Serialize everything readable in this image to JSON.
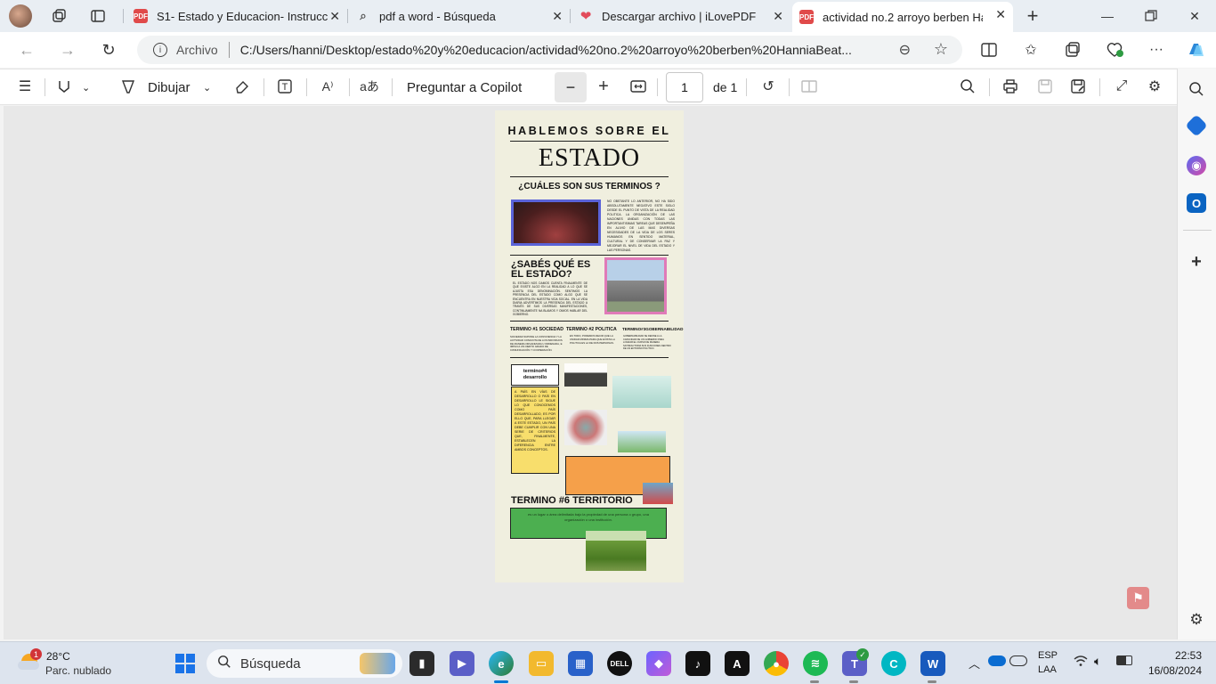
{
  "tabs": [
    {
      "title": "S1- Estado y Educacion- Instrucc",
      "favicon": "pdf-icon"
    },
    {
      "title": "pdf a word - Búsqueda",
      "favicon": "search-icon"
    },
    {
      "title": "Descargar archivo | iLovePDF",
      "favicon": "heart-icon"
    },
    {
      "title": "actividad no.2 arroyo berben Ha",
      "favicon": "pdf-icon",
      "active": true
    }
  ],
  "address": {
    "scheme": "Archivo",
    "url": "C:/Users/hanni/Desktop/estado%20y%20educacion/actividad%20no.2%20arroyo%20berben%20HanniaBeat..."
  },
  "pdf_toolbar": {
    "draw_label": "Dibujar",
    "copilot_label": "Preguntar a Copilot",
    "page_current": "1",
    "page_total": "de 1"
  },
  "document": {
    "heading_small": "HABLEMOS SOBRE EL",
    "heading_big": "ESTADO",
    "q1": "¿CUÁLES SON SUS TERMINOS ?",
    "q1_text": "NO OBSTANTE LO ANTERIOR, NO HA SIDO ABSOLUTAMENTE NEGATIVO ESTE SIGLO DESDE EL PUNTO DE VISTA DE LA REALIDAD POLITICA. LA ORGANIZACIÓN DE LAS NACIONES UNIDAS CON TODAS LAS IMPORTANTISIMAS TAREAS QUE DESEMPEÑA EN ALIVIO DE LAS MAS DIVERSAS NECESIDADES DE LA VIDA DE LOS SERES HUMANOS EN SENTIDO MATERIAL, CULTURAL Y DE CONSERVAR LA PAZ Y MEJORAR EL NIVEL DE VIDA DEL ESTADO Y LAS PERSONAS.",
    "q2": "¿SABÉS QUÉ ES EL ESTADO?",
    "q2_text": "EL ESTADO NOS DAMOS CUENTA FINALMENTE DE QUE EXISTE ALGO EN LA REALIDAD A LO QUE SE AJUSTA ESA DENOMINACIÓN. SENTIMOS LA PRESENCIA DEL ESTADO COMO ALGO QUE SE ENCUENTRA EN NUESTRA VIDA SOCIAL. EN LA VIDA DIARIA ADVERTIMOS LA PRESENCIA DEL ESTADO A TRAVÉS DE SUS DIVERSAS MANIFESTACIONES, CONTINUAMENTE NA BLAMOS Y OIMOS HABLAR DEL GOBIERNO.",
    "t1": "TERMINO #1 SOCIEDAD",
    "t1_text": "SOCIEDAD SUPONE LA CONVIVENCIA Y LA ACTIVIDAD CONJUNTA DE LOS INDIVIDUOS DE MANERA ORGANIZADA U ORDENADA, E IMPLICA UN CIERTO GRADO DE COMUNICACIÓN Y COOPERACIÓN.",
    "t2": "TERMINO #2 POLITICA",
    "t2_text": "ES TODO, PODEMOS DECIR QUE LA UNIDAD MINIMA PARA QUE EXISTA LA POLITICA ES LA DE DOS PERSONAS.",
    "t3": "TERMINO#3GOBERNABILIDAD",
    "t3_text": "GOBERNABILIDAD SE DEFINE A LA CAPACIDAD DE UN GOBIERNO PARA LOGRAR EL CURSO DE MANERA SATISFACTORIA SUS FUNCIONES DENTRO DE UN ENTORNO POLÍTICO.",
    "t4": "termino#4 desarrollo",
    "t4_text": "A PAÍS EN VÍAS DE DESARROLLO O PAÍS EN DESARROLLO LE SIGUE LO QUE CONOCEMOS COMO PAÍS DESARROLLADO, ES POR ELLO QUE, PARA LLEGAR A ESTE ESTADO, UN PAÍS DEBE CUMPLIR CON UNA SERIE DE CRITERIOS QUE, FINALMENTE, ESTABLECEN LA DIFERENCIA ENTRE AMBOS CONCEPTOS.",
    "t6": "TERMINO #6 TERRITORIO",
    "t6_text": "es un lugar o área delimitada bajo la propiedad de una persona o grupo, una organización o una institución."
  },
  "taskbar": {
    "weather_temp": "28°C",
    "weather_desc": "Parc. nublado",
    "weather_badge": "1",
    "search_placeholder": "Búsqueda",
    "lang": "ESP",
    "layout": "LAA",
    "time": "22:53",
    "date": "16/08/2024"
  },
  "colors": {
    "accent_blue": "#0078d4",
    "page_bg": "#f0efdf",
    "term4_yellow": "#f8de6c",
    "term5_orange": "#f5a04a",
    "term6_green": "#4caf50"
  }
}
